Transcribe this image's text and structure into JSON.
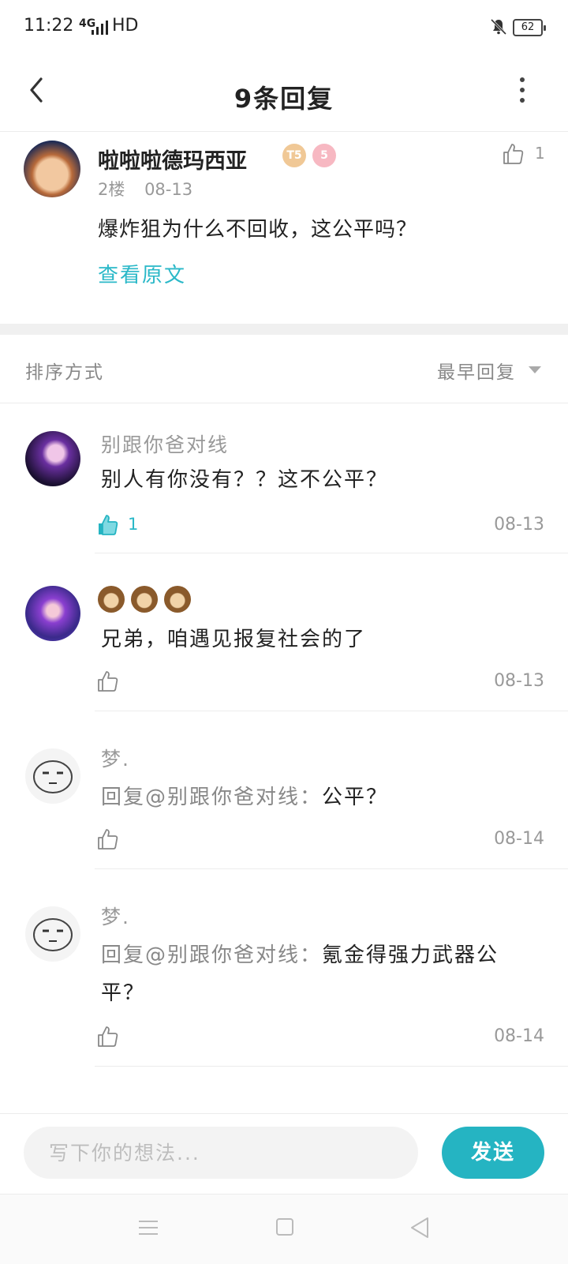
{
  "status_bar": {
    "time": "11:22",
    "network": "4G",
    "hd": "HD",
    "battery": "62"
  },
  "header": {
    "title": "9条回复"
  },
  "post": {
    "author": "啦啦啦德玛西亚",
    "badge_t": "T5",
    "badge_level": "5",
    "like_count": "1",
    "floor": "2楼",
    "date": "08-13",
    "text": "爆炸狙为什么不回收，这公平吗？",
    "view_original": "查看原文"
  },
  "sort": {
    "label": "排序方式",
    "selected": "最早回复"
  },
  "replies": [
    {
      "name": "别跟你爸对线",
      "text": "别人有你没有？？这不公平？",
      "like_count": "1",
      "liked": true,
      "date": "08-13"
    },
    {
      "name": "",
      "emoji": [
        "monkey-emoji",
        "monkey-emoji",
        "monkey-emoji"
      ],
      "text": "兄弟，咱遇见报复社会的了",
      "date": "08-13"
    },
    {
      "name": "梦.",
      "mention": "回复@别跟你爸对线：",
      "text": "公平？",
      "date": "08-14"
    },
    {
      "name": "梦.",
      "mention": "回复@别跟你爸对线：",
      "text": "氪金得强力武器公平？",
      "date": "08-14"
    }
  ],
  "input": {
    "placeholder": "写下你的想法...",
    "send_label": "发送"
  },
  "colors": {
    "accent": "#25b4c2",
    "muted": "#999999"
  }
}
